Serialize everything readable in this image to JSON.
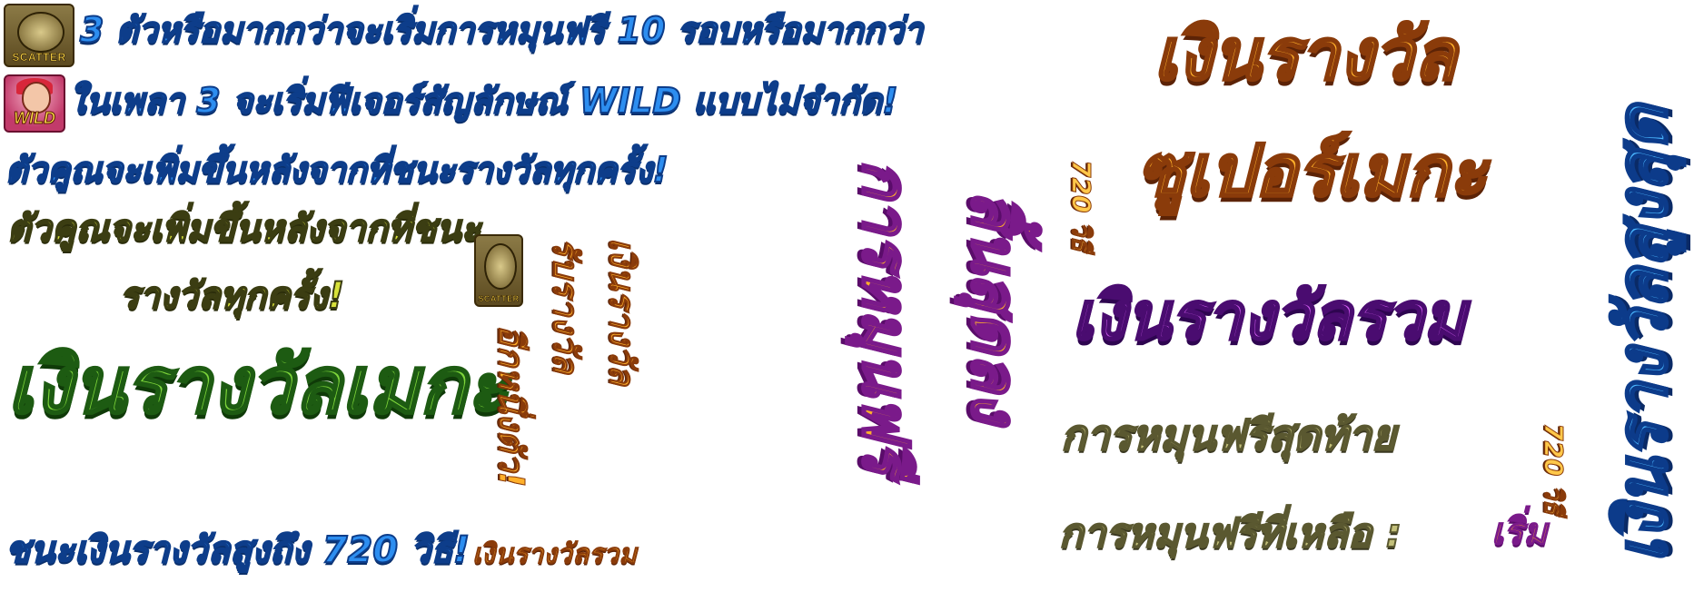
{
  "icons": {
    "scatter_label": "SCATTER",
    "wild_label": "WILD"
  },
  "lines": {
    "line1": "3 ตัวหรือมากกว่าจะเริ่มการหมุนฟรี 10 รอบหรือมากกว่า",
    "line2": "ในเพลา 3 จะเริ่มฟีเจอร์สัญลักษณ์ WILD แบบไม่จำกัด!",
    "line3": "ตัวคูณจะเพิ่มขึ้นหลังจากที่ชนะรางวัลทุกครั้ง!",
    "line4a": "ตัวคูณจะเพิ่มขึ้นหลังจากที่ชนะ",
    "line4b": "รางวัลทุกครั้ง!",
    "mega": "เงินรางวัลเมกะ",
    "win_up_to": "ชนะเงินรางวัลสูงถึง 720 วิธี!",
    "total_small": "เงินรางวัลรวม",
    "vertical_orange_1": "เงินรางวัล",
    "vertical_orange_2": "รับรางวัล",
    "vertical_orange_3": "อีกหนึ่งตัว!",
    "vertical_pink_1": "การหมุนฟรี",
    "vertical_pink_2": "สิ้นสุดลง",
    "ways_720_top": "720 วิธี",
    "super_mega_1": "เงินรางวัล",
    "super_mega_2": "ซูเปอร์เมกะ",
    "total_big": "เงินรางวัลรวม",
    "last_free_spin": "การหมุนฟรีสุดท้าย",
    "ways_720_right": "720 วิธี",
    "remaining": "การหมุนฟรีที่เหลือ :",
    "start": "เริ่ม",
    "vertical_blue": "เงินรางวัลสูงสุด"
  }
}
